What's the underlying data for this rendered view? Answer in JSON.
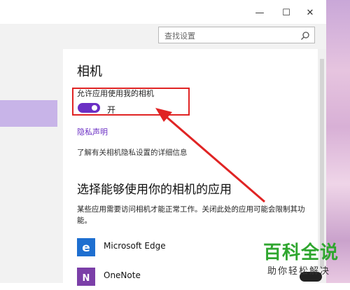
{
  "window": {
    "minimize_glyph": "—",
    "maximize_glyph": "☐",
    "close_glyph": "✕"
  },
  "search": {
    "placeholder": "查找设置"
  },
  "camera_section": {
    "title": "相机",
    "toggle_label": "允许应用使用我的相机",
    "toggle_state": "开",
    "toggle_on": true,
    "privacy_link": "隐私声明",
    "more_info": "了解有关相机隐私设置的详细信息"
  },
  "apps_section": {
    "title": "选择能够使用你的相机的应用",
    "description": "某些应用需要访问相机才能正常工作。关闭此处的应用可能会限制其功能。",
    "apps": [
      {
        "name": "Microsoft Edge",
        "icon": "edge-icon",
        "color": "#1e6fd0"
      },
      {
        "name": "OneNote",
        "icon": "onenote-icon",
        "color": "#7b3fa8"
      }
    ]
  },
  "colors": {
    "accent": "#6b2fc4",
    "highlight": "#e02424",
    "watermark": "#2fa62f"
  },
  "watermark": {
    "big": "百科全说",
    "small": "助你轻松解决"
  }
}
